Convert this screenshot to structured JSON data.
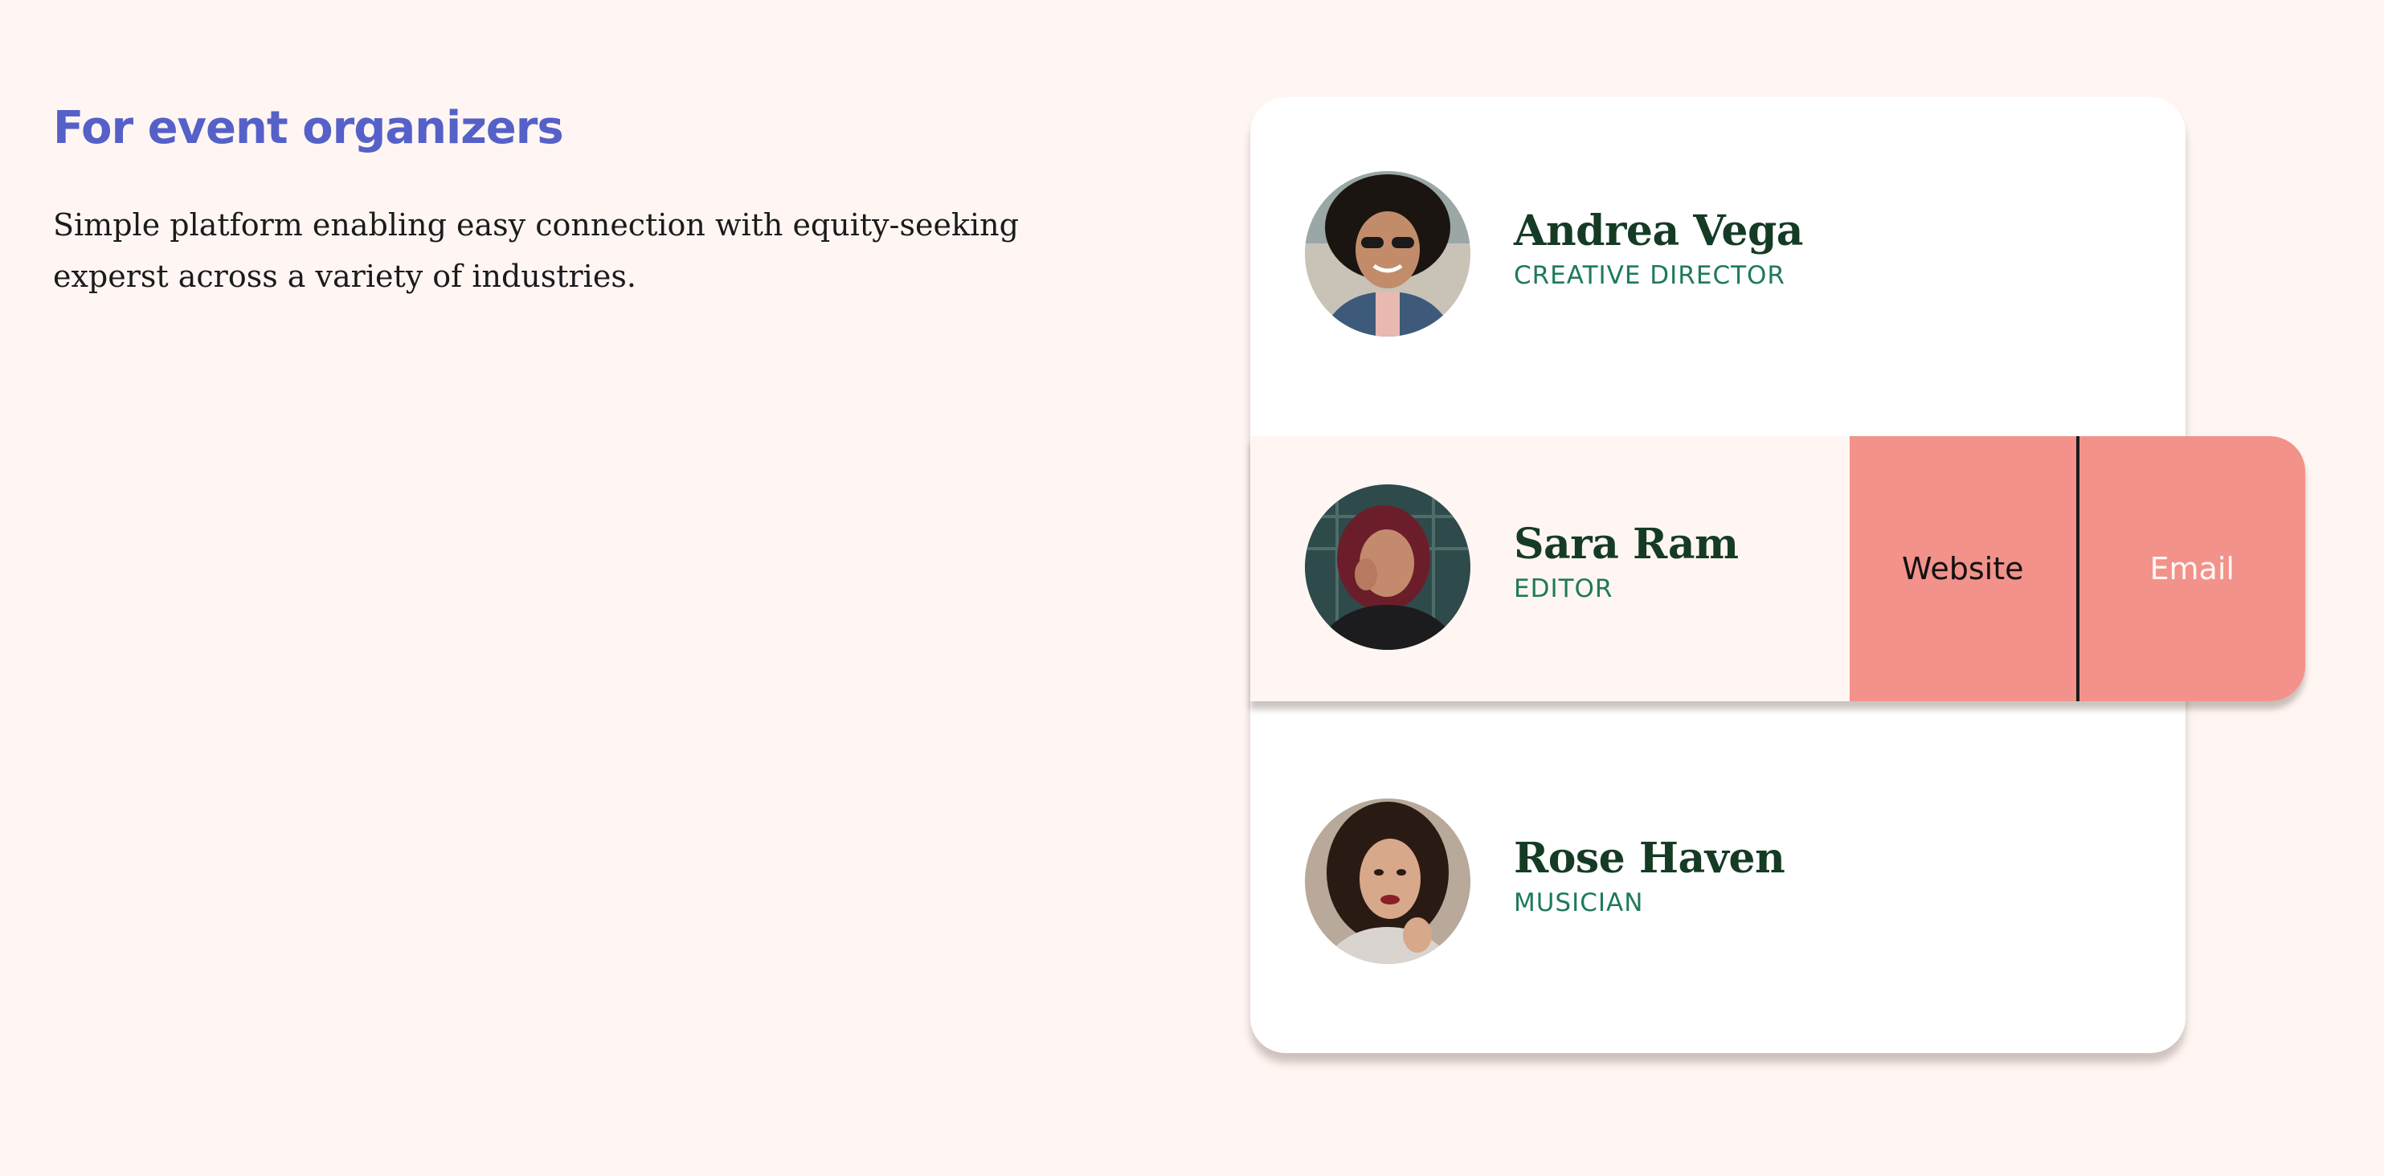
{
  "intro": {
    "heading": "For event organizers",
    "description": "Simple platform enabling easy connection with equity-seeking experst across a variety of industries."
  },
  "people": [
    {
      "name": "Andrea Vega",
      "role": "CREATIVE DIRECTOR"
    },
    {
      "name": "Sara Ram",
      "role": "EDITOR"
    },
    {
      "name": "Rose Haven",
      "role": "MUSICIAN"
    }
  ],
  "actions": {
    "website_label": "Website",
    "email_label": "Email"
  },
  "colors": {
    "page_background": "#fff6f3",
    "heading": "#5561c8",
    "name": "#153b25",
    "role": "#1f7a5a",
    "action_background": "#f2928a"
  },
  "icons": {
    "avatar_1": "avatar-photo",
    "avatar_2": "avatar-photo",
    "avatar_3": "avatar-photo"
  }
}
